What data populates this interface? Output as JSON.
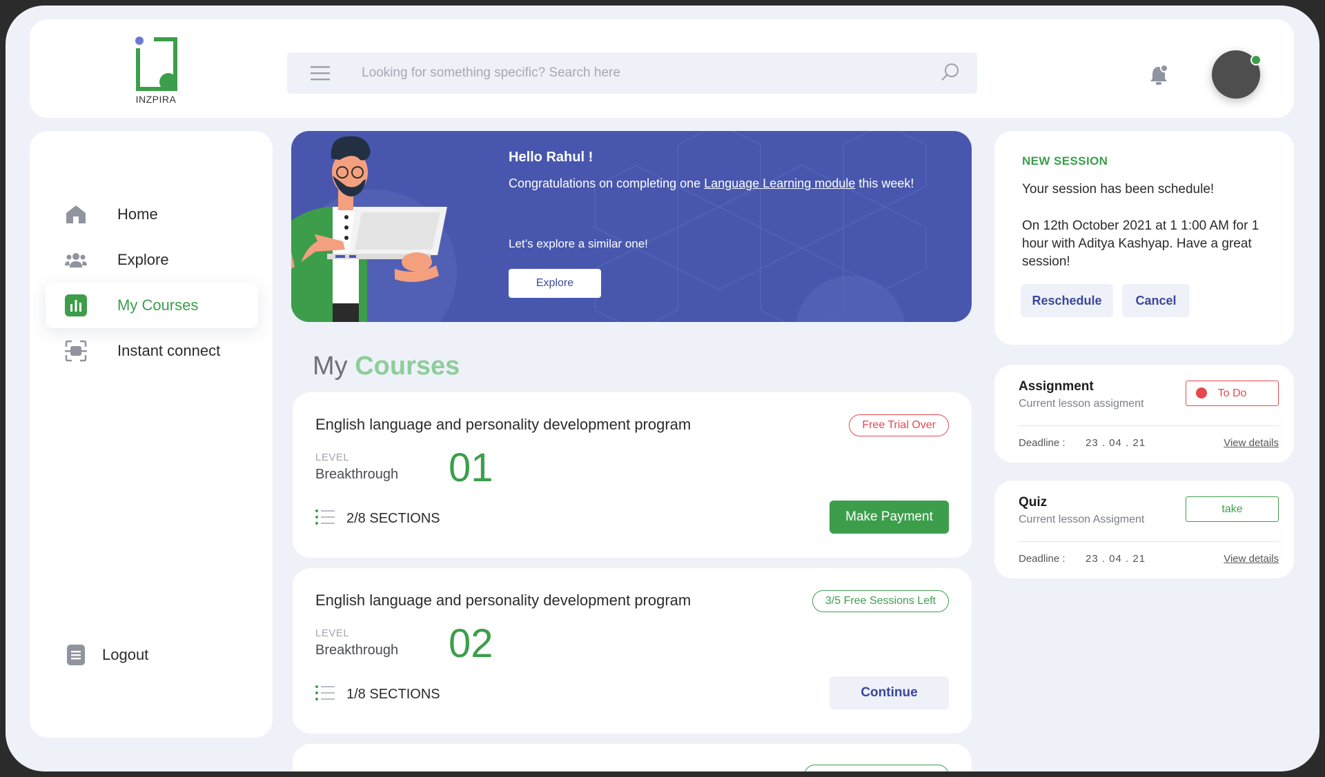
{
  "brand": {
    "name": "INZPIRA"
  },
  "header": {
    "search_placeholder": "Looking for something specific? Search here"
  },
  "sidebar": {
    "items": [
      {
        "label": "Home",
        "icon": "home-icon"
      },
      {
        "label": "Explore",
        "icon": "users-icon"
      },
      {
        "label": "My Courses",
        "icon": "bar-chart-icon",
        "active": true
      },
      {
        "label": "Instant connect",
        "icon": "scan-icon"
      }
    ],
    "logout": {
      "label": "Logout",
      "icon": "document-icon"
    }
  },
  "banner": {
    "greeting": "Hello Rahul !",
    "message_prefix": "Congratulations on completing one ",
    "message_link": "Language Learning module",
    "message_suffix": " this week!",
    "sub": "Let’s explore a similar one!",
    "button": "Explore"
  },
  "courses_heading": {
    "prefix": "My",
    "accent": "Courses"
  },
  "courses": [
    {
      "title": "English language and personality development program",
      "badge": "Free Trial Over",
      "level_label": "LEVEL",
      "level_name": "Breakthrough",
      "number": "01",
      "sections": "2/8 SECTIONS",
      "action": "Make Payment"
    },
    {
      "title": "English language and personality development program",
      "badge": "3/5 Free Sessions Left",
      "level_label": "LEVEL",
      "level_name": "Breakthrough",
      "number": "02",
      "sections": "1/8 SECTIONS",
      "action": "Continue"
    }
  ],
  "session": {
    "heading": "NEW SESSION",
    "line1": "Your session has been schedule!",
    "line2": "On 12th October 2021 at 1 1:00 AM for 1 hour with Aditya Kashyap. Have a great session!",
    "reschedule": "Reschedule",
    "cancel": "Cancel"
  },
  "tasks": [
    {
      "title": "Assignment",
      "subtitle": "Current lesson assigment",
      "button": "To Do",
      "deadline_label": "Deadline :",
      "deadline": "23 . 04 . 21",
      "link": "View details"
    },
    {
      "title": "Quiz",
      "subtitle": "Current lesson Assigment",
      "button": "take",
      "deadline_label": "Deadline :",
      "deadline": "23 . 04 . 21",
      "link": "View details"
    }
  ],
  "colors": {
    "primary_green": "#3c9e4b",
    "banner_blue": "#4857ad",
    "accent_red": "#e5484d",
    "background": "#eef1f8"
  }
}
